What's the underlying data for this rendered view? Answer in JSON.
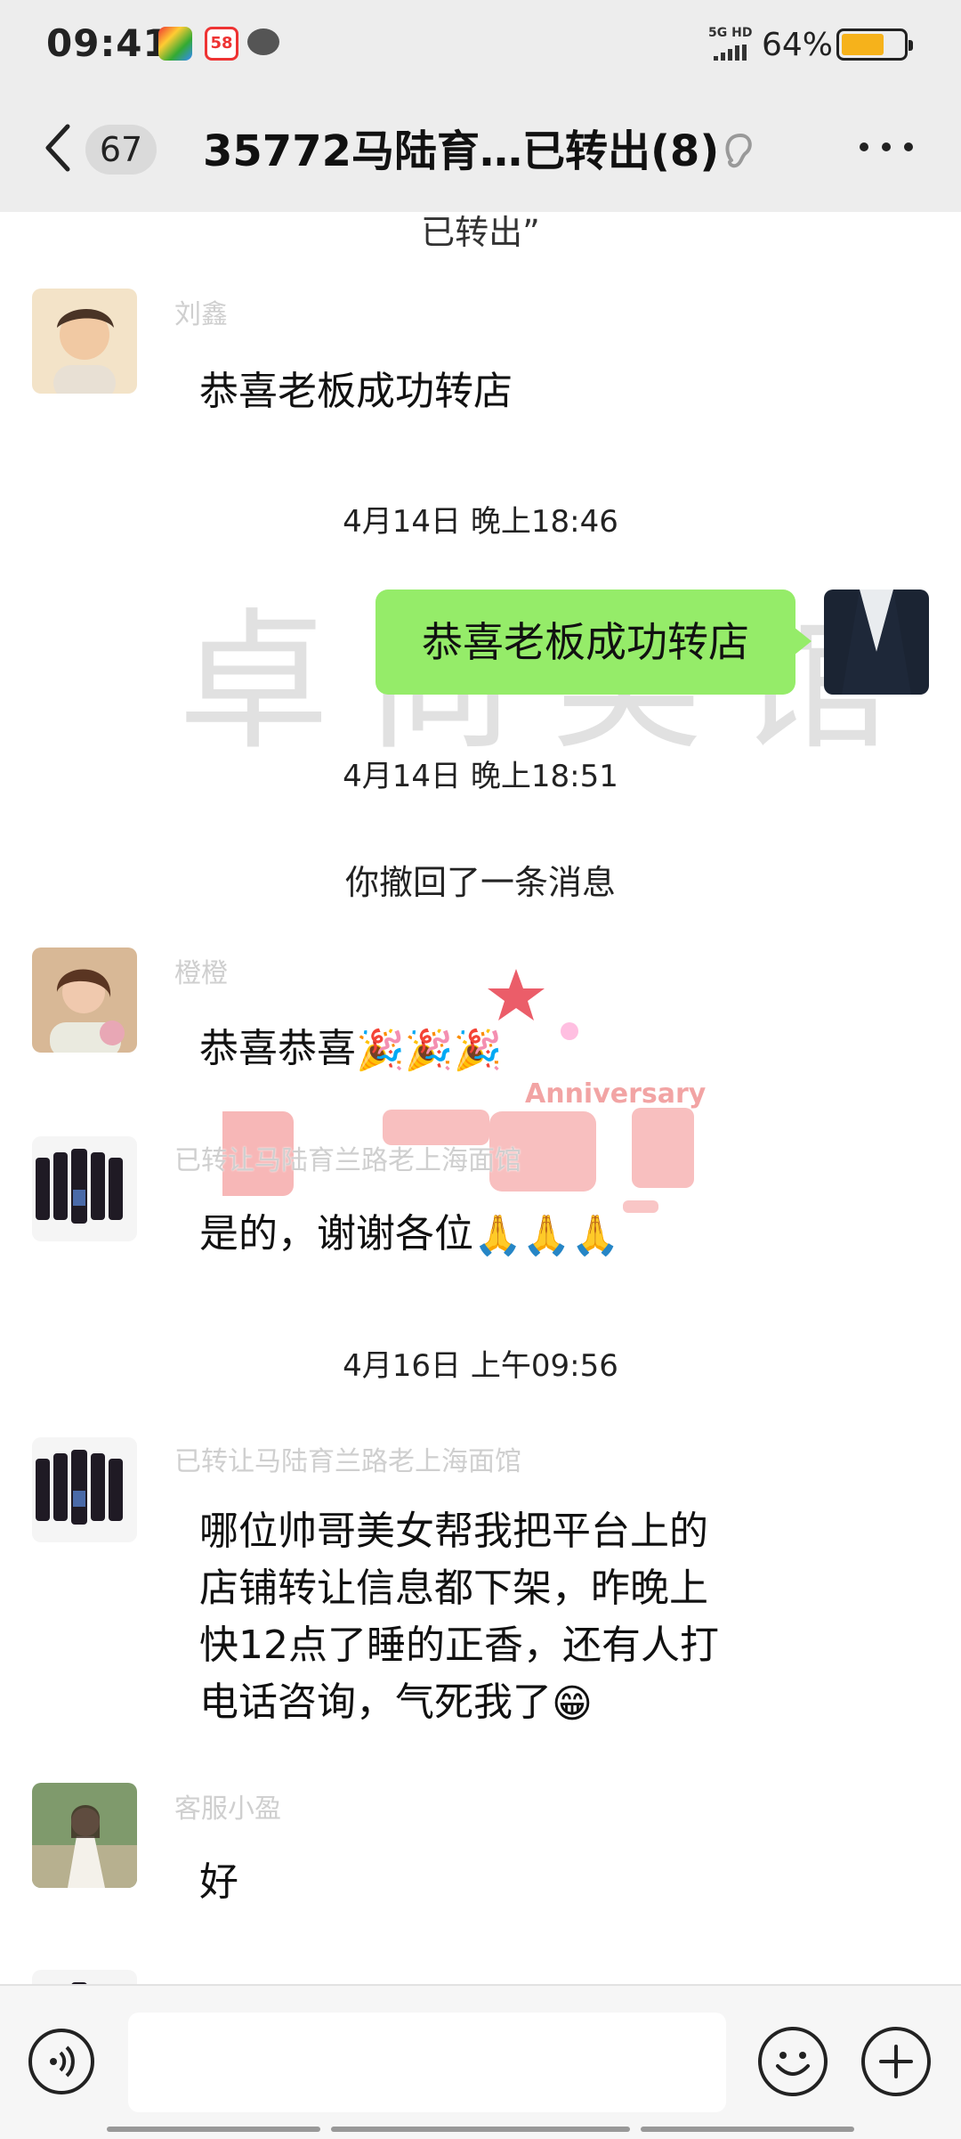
{
  "status_bar": {
    "time": "09:41",
    "network": "5G HD",
    "battery_pct": "64%",
    "battery_level": 0.64,
    "notif_58": "58"
  },
  "header": {
    "unread_count": "67",
    "title": "35772马陆育…已转出(8)"
  },
  "chat": {
    "top_partial": "已转出”",
    "messages": [
      {
        "sender": "刘鑫",
        "text": "恭喜老板成功转店"
      },
      {
        "time": "4月14日 晚上18:46"
      },
      {
        "self_text": "恭喜老板成功转店"
      },
      {
        "time": "4月14日 晚上18:51"
      },
      {
        "system": "你撤回了一条消息"
      },
      {
        "sender": "橙橙",
        "text": "恭喜恭喜"
      },
      {
        "sender": "已转让马陆育兰路老上海面馆",
        "text": "是的，谢谢各位"
      },
      {
        "time": "4月16日 上午09:56"
      },
      {
        "sender": "已转让马陆育兰路老上海面馆",
        "lines": [
          "哪位帅哥美女帮我把平台上的",
          "店铺转让信息都下架，昨晚上",
          "快12点了睡的正香，还有人打",
          "电话咨询，气死我了"
        ]
      },
      {
        "sender": "客服小盈",
        "text": "好"
      }
    ],
    "watermark_text": "卓尚美馆",
    "anniversary_text": "Anniversary"
  },
  "icons": {
    "back": "chevron-left-icon",
    "mute": "ear-icon",
    "more": "more-dots-icon",
    "voice": "voice-icon",
    "emoji": "emoji-icon",
    "plus": "plus-icon"
  },
  "colors": {
    "self_bubble": "#95ec69",
    "battery": "#f6b21b",
    "header_bg": "#ededed"
  }
}
